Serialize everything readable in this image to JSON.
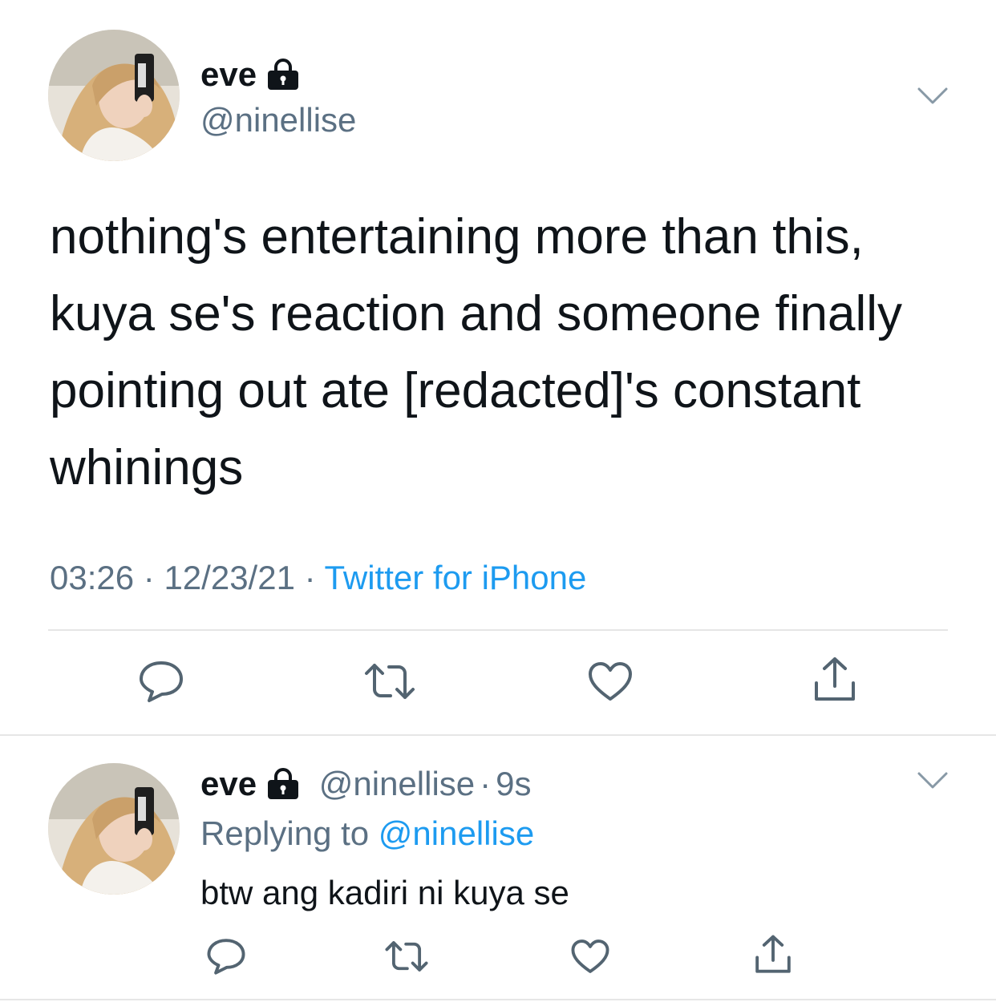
{
  "tweet": {
    "author": {
      "name": "eve",
      "handle": "@ninellise",
      "avatar_icon": "profile-photo",
      "protected_icon": "lock-icon"
    },
    "text": "nothing's entertaining more than this, kuya se's reaction and someone finally pointing out ate [redacted]'s constant whinings",
    "time": "03:26",
    "date": "12/23/21",
    "separator": "·",
    "source": "Twitter for iPhone",
    "actions": [
      "reply-icon",
      "retweet-icon",
      "like-icon",
      "share-icon"
    ]
  },
  "reply": {
    "author": {
      "name": "eve",
      "handle": "@ninellise",
      "avatar_icon": "profile-photo",
      "protected_icon": "lock-icon"
    },
    "separator": "·",
    "age": "9s",
    "replying_label": "Replying to",
    "replying_to": "@ninellise",
    "text": "btw ang kadiri ni kuya se",
    "actions": [
      "reply-icon",
      "retweet-icon",
      "like-icon",
      "share-icon"
    ]
  },
  "colors": {
    "text": "#0f1419",
    "secondary": "#5b7083",
    "link": "#1d9bf0",
    "divider": "#e6e6e6"
  }
}
